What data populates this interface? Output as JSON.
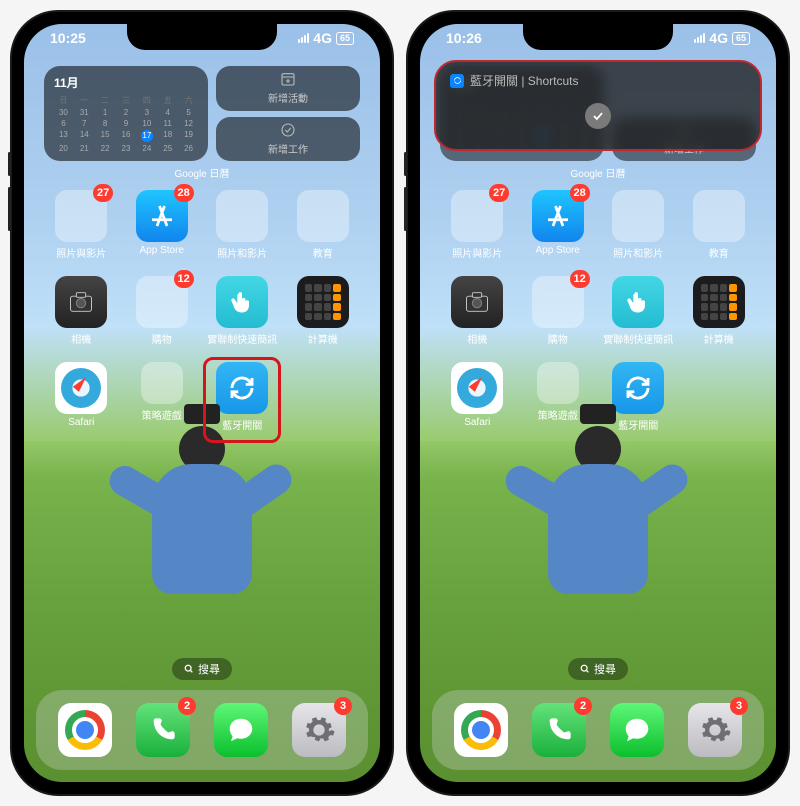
{
  "status": {
    "time_left": "10:25",
    "time_right": "10:26",
    "network": "4G",
    "battery": "65"
  },
  "widget": {
    "month": "11月",
    "weekdays": [
      "日",
      "一",
      "二",
      "三",
      "四",
      "五",
      "六"
    ],
    "today": "17",
    "new_event": "新增活動",
    "new_task": "新增工作",
    "caption": "Google 日曆"
  },
  "notification": {
    "title": "藍牙開關 | Shortcuts"
  },
  "apps": {
    "row1": [
      {
        "label": "照片與影片",
        "type": "folder",
        "badge": "27"
      },
      {
        "label": "App Store",
        "type": "appstore",
        "badge": "28"
      },
      {
        "label": "照片和影片",
        "type": "folder"
      },
      {
        "label": "教育",
        "type": "folder"
      }
    ],
    "row2": [
      {
        "label": "相機",
        "type": "camera"
      },
      {
        "label": "購物",
        "type": "folder",
        "badge": "12"
      },
      {
        "label": "實聯制快速簡訊",
        "type": "hand"
      },
      {
        "label": "計算機",
        "type": "calc"
      }
    ],
    "row3": [
      {
        "label": "Safari",
        "type": "safari"
      },
      {
        "label": "策略遊戲",
        "type": "folder-small"
      },
      {
        "label": "藍牙開關",
        "type": "sync",
        "highlight_left": true
      }
    ]
  },
  "search": "搜尋",
  "dock": {
    "badges": {
      "phone": "2",
      "settings": "3"
    }
  }
}
